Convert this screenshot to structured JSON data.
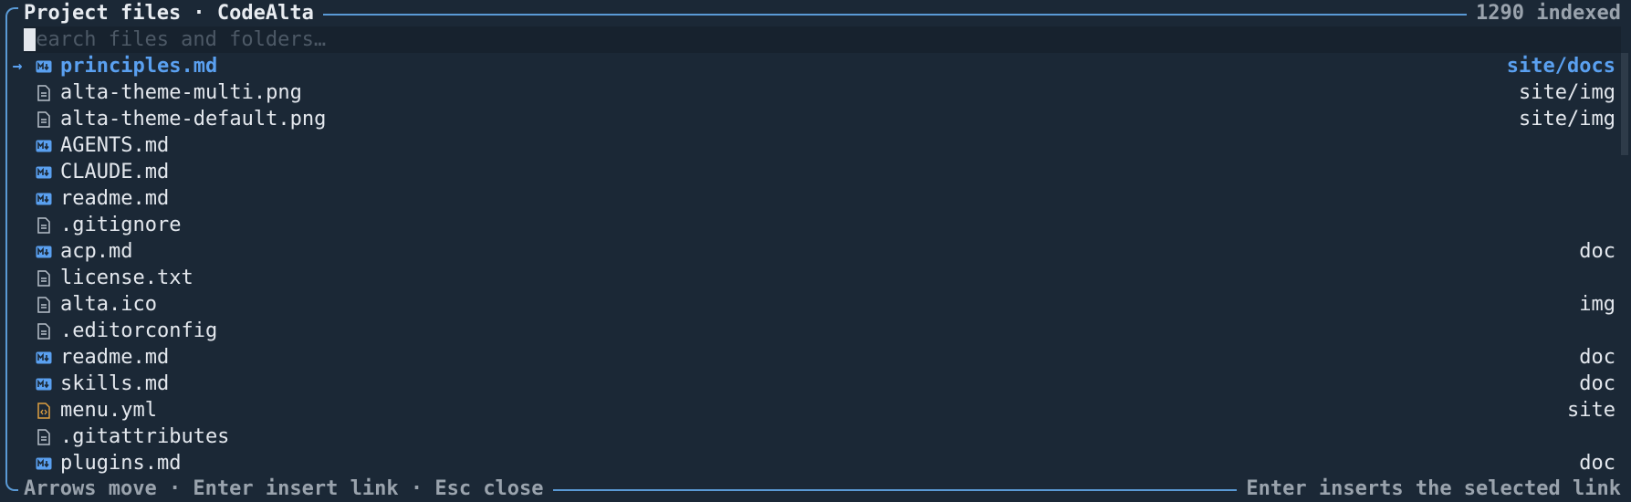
{
  "header": {
    "title": "Project files · CodeAlta",
    "count": "1290 indexed"
  },
  "search": {
    "placeholder": "Search files and folders…",
    "value": ""
  },
  "selection_marker": "→",
  "files": [
    {
      "name": "principles.md",
      "dir": "site/docs",
      "icon": "markdown-icon",
      "selected": true
    },
    {
      "name": "alta-theme-multi.png",
      "dir": "site/img",
      "icon": "file-icon",
      "selected": false
    },
    {
      "name": "alta-theme-default.png",
      "dir": "site/img",
      "icon": "file-icon",
      "selected": false
    },
    {
      "name": "AGENTS.md",
      "dir": "",
      "icon": "markdown-icon",
      "selected": false
    },
    {
      "name": "CLAUDE.md",
      "dir": "",
      "icon": "markdown-icon",
      "selected": false
    },
    {
      "name": "readme.md",
      "dir": "",
      "icon": "markdown-icon",
      "selected": false
    },
    {
      "name": ".gitignore",
      "dir": "",
      "icon": "file-icon",
      "selected": false
    },
    {
      "name": "acp.md",
      "dir": "doc",
      "icon": "markdown-icon",
      "selected": false
    },
    {
      "name": "license.txt",
      "dir": "",
      "icon": "file-icon",
      "selected": false
    },
    {
      "name": "alta.ico",
      "dir": "img",
      "icon": "file-icon",
      "selected": false
    },
    {
      "name": ".editorconfig",
      "dir": "",
      "icon": "file-icon",
      "selected": false
    },
    {
      "name": "readme.md",
      "dir": "doc",
      "icon": "markdown-icon",
      "selected": false
    },
    {
      "name": "skills.md",
      "dir": "doc",
      "icon": "markdown-icon",
      "selected": false
    },
    {
      "name": "menu.yml",
      "dir": "site",
      "icon": "code-file-icon",
      "selected": false
    },
    {
      "name": ".gitattributes",
      "dir": "",
      "icon": "file-icon",
      "selected": false
    },
    {
      "name": "plugins.md",
      "dir": "doc",
      "icon": "markdown-icon",
      "selected": false
    }
  ],
  "footer": {
    "hints": "Arrows move · Enter insert link · Esc close",
    "right": "Enter inserts the selected link"
  },
  "colors": {
    "background": "#1b2836",
    "border": "#5a9ad6",
    "accent": "#5aa0f0",
    "markdown_icon": "#5aa0f0",
    "file_icon": "#b8c0ca",
    "code_icon": "#e0a040"
  }
}
